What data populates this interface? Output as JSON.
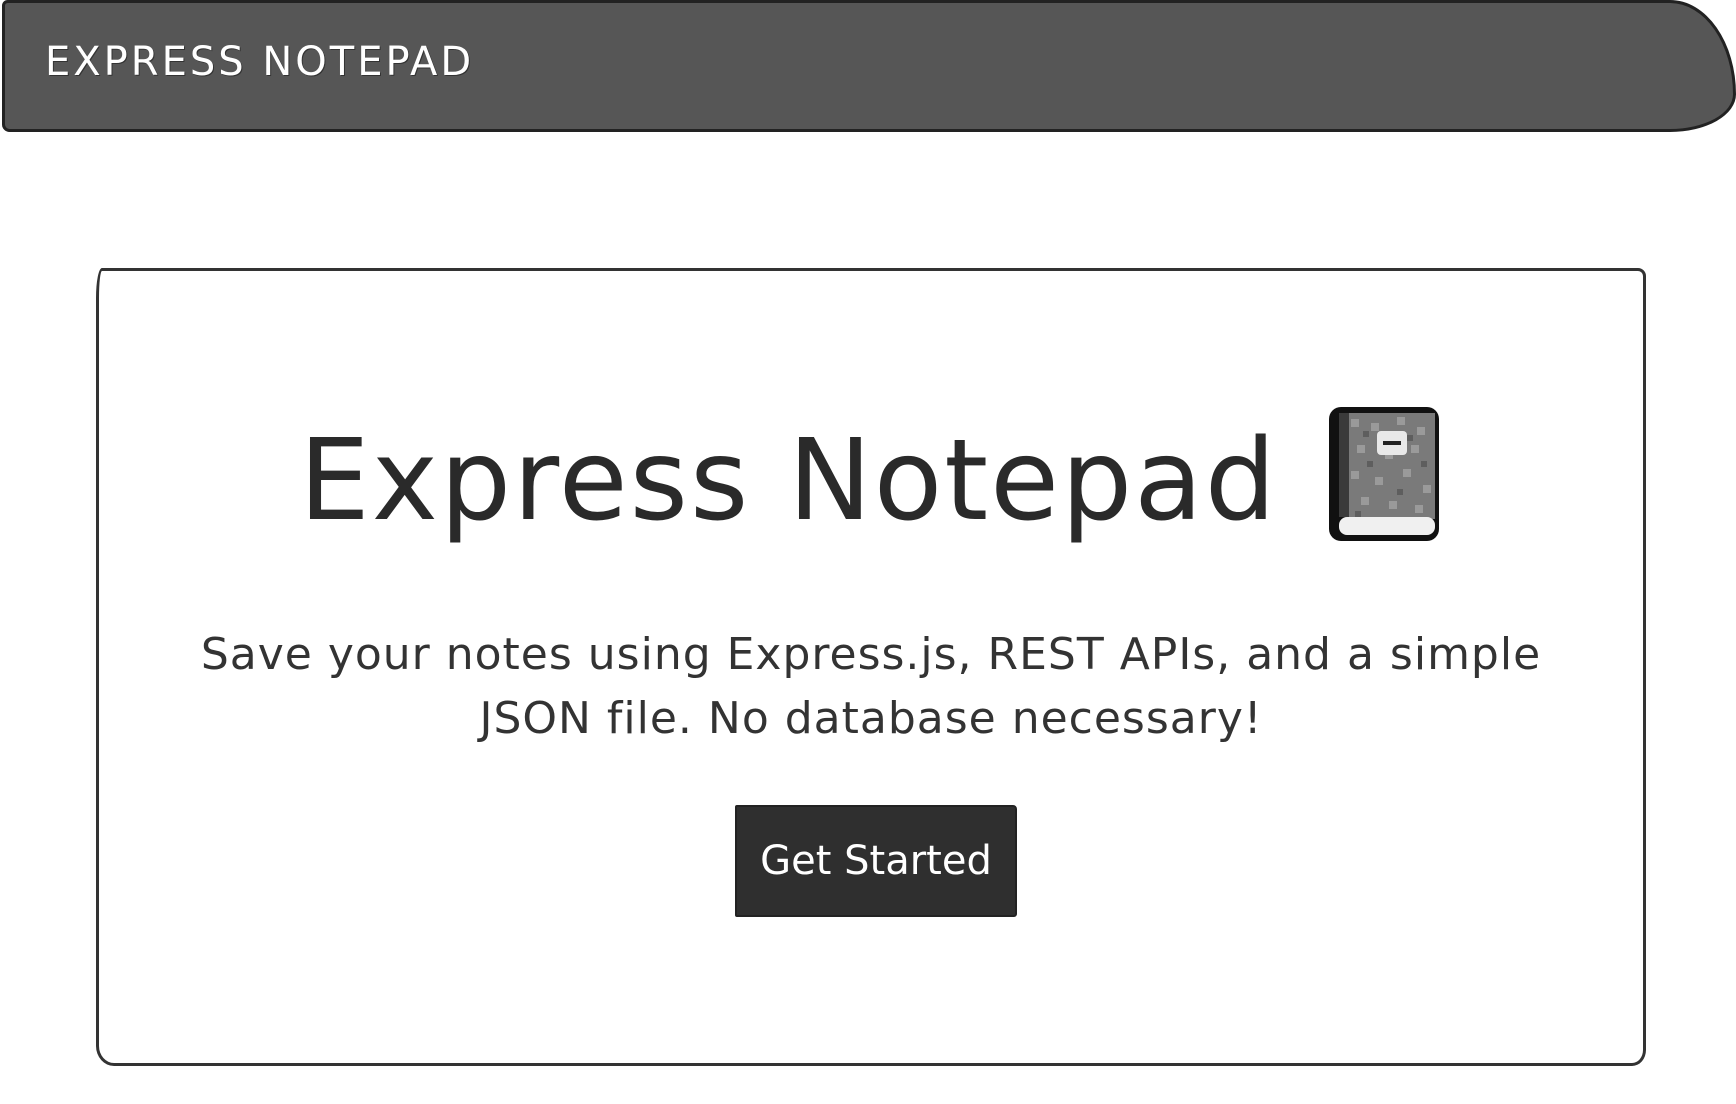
{
  "navbar": {
    "brand": "EXPRESS NOTEPAD",
    "background": "#565656"
  },
  "hero": {
    "title": "Express Notepad",
    "title_icon": "notebook-icon",
    "lead": "Save your notes using Express.js, REST APIs, and a simple JSON file. No database necessary!",
    "button_label": "Get Started",
    "button_color": "#2f2f2f"
  }
}
